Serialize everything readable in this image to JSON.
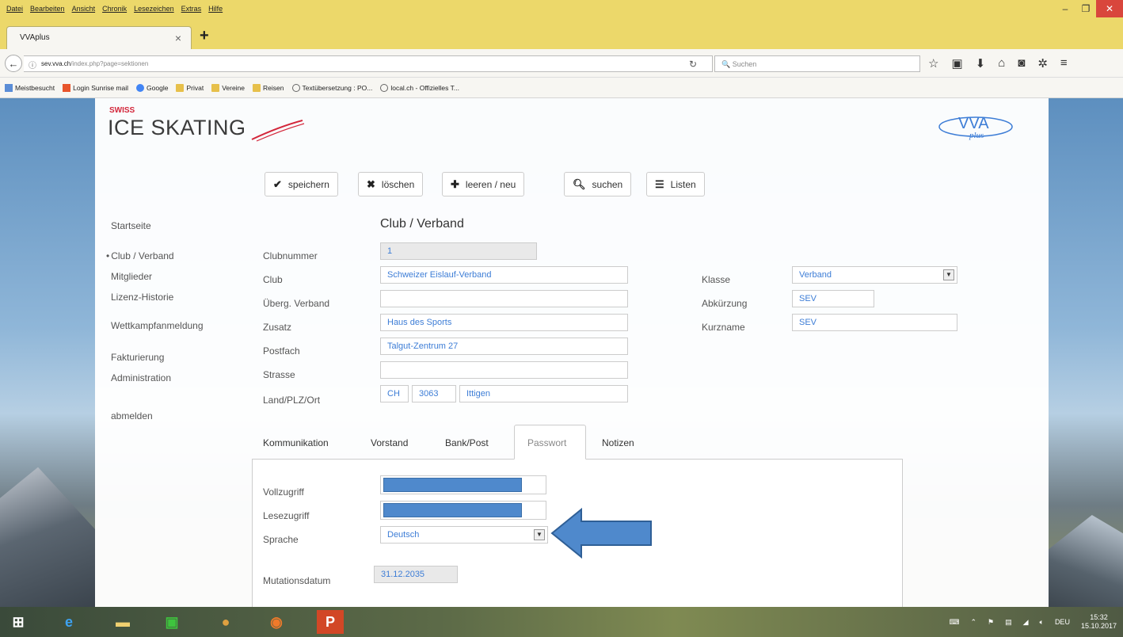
{
  "browser": {
    "menu": [
      "Datei",
      "Bearbeiten",
      "Ansicht",
      "Chronik",
      "Lesezeichen",
      "Extras",
      "Hilfe"
    ],
    "tab_title": "VVAplus",
    "url_host": "sev.vva.ch",
    "url_path": "/index.php?page=sektionen",
    "search_placeholder": "Suchen",
    "bookmarks": [
      "Meistbesucht",
      "Login Sunrise mail",
      "Google",
      "Privat",
      "Vereine",
      "Reisen",
      "Textübersetzung : PO...",
      "local.ch - Offizielles T..."
    ]
  },
  "logos": {
    "swiss": "SWISS",
    "ice_skating": "ICE SKATING",
    "vva": "VVA",
    "plus": "plus"
  },
  "toolbar": {
    "save": "speichern",
    "delete": "löschen",
    "new": "leeren / neu",
    "search": "suchen",
    "lists": "Listen"
  },
  "nav": {
    "home": "Startseite",
    "club": "Club / Verband",
    "members": "Mitglieder",
    "license_history": "Lizenz-Historie",
    "competition": "Wettkampfanmeldung",
    "billing": "Fakturierung",
    "admin": "Administration",
    "logout": "abmelden"
  },
  "form": {
    "title": "Club / Verband",
    "clubnummer_label": "Clubnummer",
    "clubnummer": "1",
    "club_label": "Club",
    "club": "Schweizer Eislauf-Verband",
    "parent_label": "Überg. Verband",
    "parent": "",
    "zusatz_label": "Zusatz",
    "zusatz": "Haus des Sports",
    "postfach_label": "Postfach",
    "postfach": "Talgut-Zentrum 27",
    "strasse_label": "Strasse",
    "strasse": "",
    "ort_label": "Land/PLZ/Ort",
    "land": "CH",
    "plz": "3063",
    "ort": "Ittigen",
    "klasse_label": "Klasse",
    "klasse": "Verband",
    "abk_label": "Abkürzung",
    "abk": "SEV",
    "kurzname_label": "Kurzname",
    "kurzname": "SEV"
  },
  "tabs": [
    "Kommunikation",
    "Vorstand",
    "Bank/Post",
    "Passwort",
    "Notizen"
  ],
  "password_tab": {
    "vollzugriff_label": "Vollzugriff",
    "lesezugriff_label": "Lesezugriff",
    "sprache_label": "Sprache",
    "sprache": "Deutsch",
    "mutation_label": "Mutationsdatum",
    "mutation": "31.12.2035"
  },
  "taskbar": {
    "lang": "DEU",
    "time": "15:32",
    "date": "15.10.2017"
  },
  "colors": {
    "accent": "#3d7dd6",
    "logo_red": "#d3263a",
    "firefox_bar": "#ecd86a",
    "arrow": "#4f89cc"
  }
}
